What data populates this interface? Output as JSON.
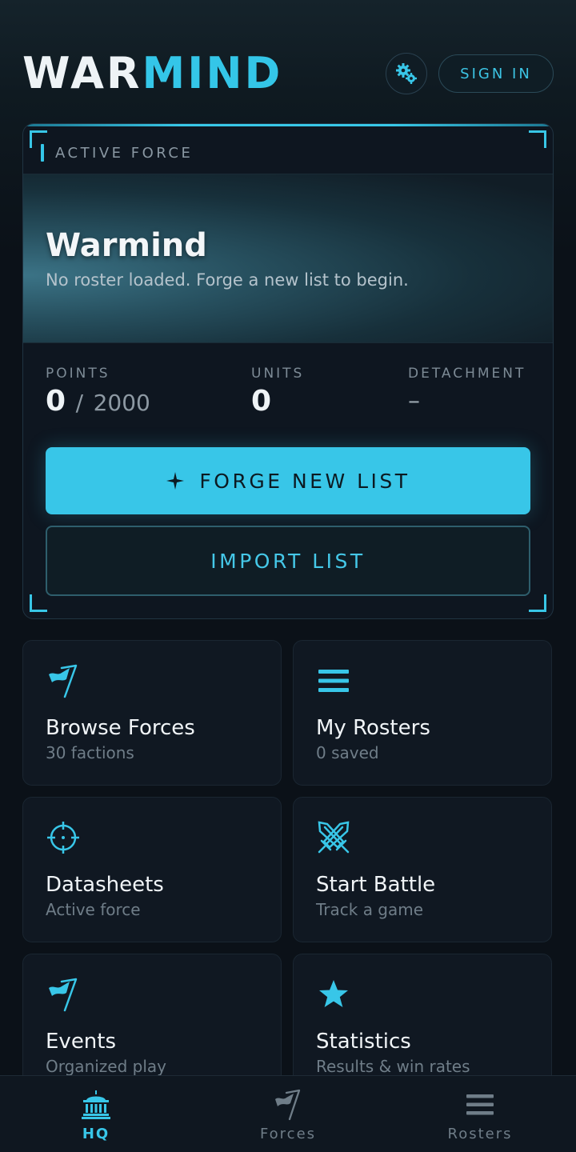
{
  "header": {
    "logo_part1": "WAR",
    "logo_part2": "MIND",
    "settings_icon": "gears-icon",
    "sign_in_label": "SIGN IN"
  },
  "active_force": {
    "label": "ACTIVE FORCE",
    "title": "Warmind",
    "subtitle": "No roster loaded. Forge a new list to begin.",
    "stats": {
      "points_label": "POINTS",
      "points_value": "0",
      "points_separator": "/",
      "points_limit": "2000",
      "units_label": "UNITS",
      "units_value": "0",
      "detachment_label": "DETACHMENT",
      "detachment_value": "–"
    },
    "forge_button_label": "FORGE NEW LIST",
    "import_button_label": "IMPORT LIST"
  },
  "tiles": [
    {
      "title": "Browse Forces",
      "subtitle": "30 factions",
      "icon": "flag-icon"
    },
    {
      "title": "My Rosters",
      "subtitle": "0 saved",
      "icon": "list-icon"
    },
    {
      "title": "Datasheets",
      "subtitle": "Active force",
      "icon": "crosshair-icon"
    },
    {
      "title": "Start Battle",
      "subtitle": "Track a game",
      "icon": "crossed-swords-icon"
    },
    {
      "title": "Events",
      "subtitle": "Organized play",
      "icon": "flag-icon"
    },
    {
      "title": "Statistics",
      "subtitle": "Results & win rates",
      "icon": "star-icon"
    }
  ],
  "bottom_nav": [
    {
      "label": "HQ",
      "icon": "temple-icon",
      "active": true
    },
    {
      "label": "Forces",
      "icon": "flag-icon",
      "active": false
    },
    {
      "label": "Rosters",
      "icon": "list-icon",
      "active": false
    }
  ],
  "colors": {
    "accent": "#38c6e8",
    "background": "#0b1118",
    "card": "#101822"
  }
}
